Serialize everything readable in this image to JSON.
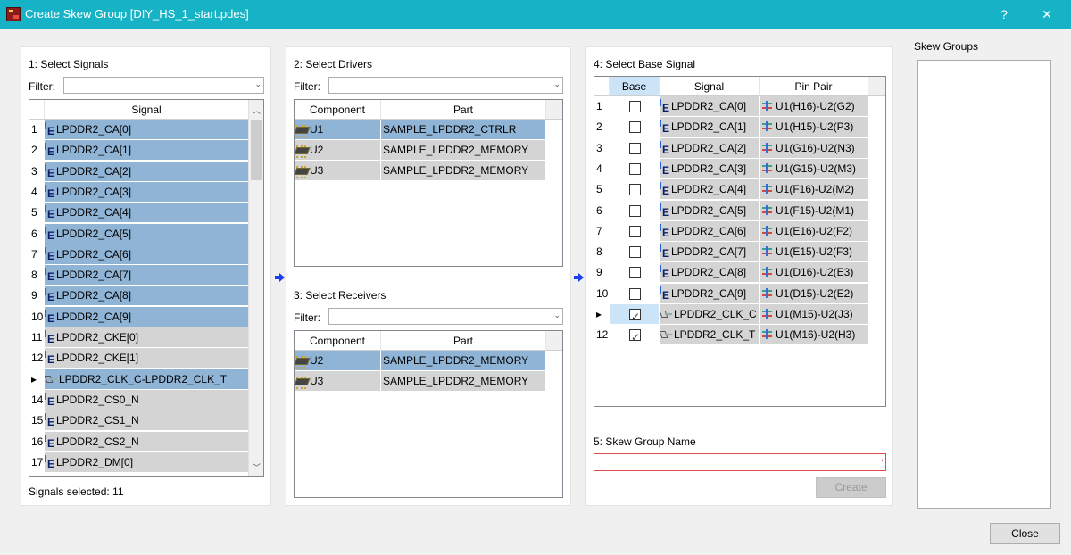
{
  "window": {
    "title": "Create Skew Group [DIY_HS_1_start.pdes]",
    "help": "?",
    "close": "✕"
  },
  "signals_panel": {
    "title": "1:  Select Signals",
    "filter_label": "Filter:",
    "filter_value": "",
    "column": "Signal",
    "rows": [
      {
        "n": "1",
        "name": "LPDDR2_CA[0]",
        "icon": "e-net-icon",
        "selected": true
      },
      {
        "n": "2",
        "name": "LPDDR2_CA[1]",
        "icon": "e-net-icon",
        "selected": true
      },
      {
        "n": "3",
        "name": "LPDDR2_CA[2]",
        "icon": "e-net-icon",
        "selected": true
      },
      {
        "n": "4",
        "name": "LPDDR2_CA[3]",
        "icon": "e-net-icon",
        "selected": true
      },
      {
        "n": "5",
        "name": "LPDDR2_CA[4]",
        "icon": "e-net-icon",
        "selected": true
      },
      {
        "n": "6",
        "name": "LPDDR2_CA[5]",
        "icon": "e-net-icon",
        "selected": true
      },
      {
        "n": "7",
        "name": "LPDDR2_CA[6]",
        "icon": "e-net-icon",
        "selected": true
      },
      {
        "n": "8",
        "name": "LPDDR2_CA[7]",
        "icon": "e-net-icon",
        "selected": true
      },
      {
        "n": "9",
        "name": "LPDDR2_CA[8]",
        "icon": "e-net-icon",
        "selected": true
      },
      {
        "n": "10",
        "name": "LPDDR2_CA[9]",
        "icon": "e-net-icon",
        "selected": true
      },
      {
        "n": "11",
        "name": "LPDDR2_CKE[0]",
        "icon": "e-net-icon",
        "selected": false
      },
      {
        "n": "12",
        "name": "LPDDR2_CKE[1]",
        "icon": "e-net-icon",
        "selected": false
      },
      {
        "n": "▸",
        "name": "LPDDR2_CLK_C-LPDDR2_CLK_T",
        "icon": "diff-pair-icon",
        "selected": true
      },
      {
        "n": "14",
        "name": "LPDDR2_CS0_N",
        "icon": "e-net-icon",
        "selected": false
      },
      {
        "n": "15",
        "name": "LPDDR2_CS1_N",
        "icon": "e-net-icon",
        "selected": false
      },
      {
        "n": "16",
        "name": "LPDDR2_CS2_N",
        "icon": "e-net-icon",
        "selected": false
      },
      {
        "n": "17",
        "name": "LPDDR2_DM[0]",
        "icon": "e-net-icon",
        "selected": false
      }
    ],
    "status": "Signals selected: 11"
  },
  "drivers_panel": {
    "title": "2:  Select Drivers",
    "filter_label": "Filter:",
    "columns": [
      "Component",
      "Part"
    ],
    "rows": [
      {
        "component": "U1",
        "part": "SAMPLE_LPDDR2_CTRLR",
        "selected": true
      },
      {
        "component": "U2",
        "part": "SAMPLE_LPDDR2_MEMORY",
        "selected": false
      },
      {
        "component": "U3",
        "part": "SAMPLE_LPDDR2_MEMORY",
        "selected": false
      }
    ]
  },
  "receivers_panel": {
    "title": "3:  Select Receivers",
    "filter_label": "Filter:",
    "columns": [
      "Component",
      "Part"
    ],
    "rows": [
      {
        "component": "U2",
        "part": "SAMPLE_LPDDR2_MEMORY",
        "selected": true
      },
      {
        "component": "U3",
        "part": "SAMPLE_LPDDR2_MEMORY",
        "selected": false
      }
    ]
  },
  "base_panel": {
    "title": "4:  Select Base Signal",
    "columns": [
      "Base",
      "Signal",
      "Pin Pair"
    ],
    "rows": [
      {
        "n": "1",
        "base": false,
        "signal": "LPDDR2_CA[0]",
        "pin_pair": "U1(H16)-U2(G2)",
        "icon": "e-net-icon"
      },
      {
        "n": "2",
        "base": false,
        "signal": "LPDDR2_CA[1]",
        "pin_pair": "U1(H15)-U2(P3)",
        "icon": "e-net-icon"
      },
      {
        "n": "3",
        "base": false,
        "signal": "LPDDR2_CA[2]",
        "pin_pair": "U1(G16)-U2(N3)",
        "icon": "e-net-icon"
      },
      {
        "n": "4",
        "base": false,
        "signal": "LPDDR2_CA[3]",
        "pin_pair": "U1(G15)-U2(M3)",
        "icon": "e-net-icon"
      },
      {
        "n": "5",
        "base": false,
        "signal": "LPDDR2_CA[4]",
        "pin_pair": "U1(F16)-U2(M2)",
        "icon": "e-net-icon"
      },
      {
        "n": "6",
        "base": false,
        "signal": "LPDDR2_CA[5]",
        "pin_pair": "U1(F15)-U2(M1)",
        "icon": "e-net-icon"
      },
      {
        "n": "7",
        "base": false,
        "signal": "LPDDR2_CA[6]",
        "pin_pair": "U1(E16)-U2(F2)",
        "icon": "e-net-icon"
      },
      {
        "n": "8",
        "base": false,
        "signal": "LPDDR2_CA[7]",
        "pin_pair": "U1(E15)-U2(F3)",
        "icon": "e-net-icon"
      },
      {
        "n": "9",
        "base": false,
        "signal": "LPDDR2_CA[8]",
        "pin_pair": "U1(D16)-U2(E3)",
        "icon": "e-net-icon"
      },
      {
        "n": "10",
        "base": false,
        "signal": "LPDDR2_CA[9]",
        "pin_pair": "U1(D15)-U2(E2)",
        "icon": "e-net-icon"
      },
      {
        "n": "▸",
        "base": true,
        "signal": "LPDDR2_CLK_C",
        "pin_pair": "U1(M15)-U2(J3)",
        "icon": "diff-pair-icon"
      },
      {
        "n": "12",
        "base": true,
        "signal": "LPDDR2_CLK_T",
        "pin_pair": "U1(M16)-U2(H3)",
        "icon": "diff-pair-icon"
      }
    ]
  },
  "name_panel": {
    "title": "5: Skew Group Name",
    "value": "",
    "create_label": "Create"
  },
  "skew_groups": {
    "title": "Skew Groups"
  },
  "footer": {
    "close_label": "Close"
  }
}
